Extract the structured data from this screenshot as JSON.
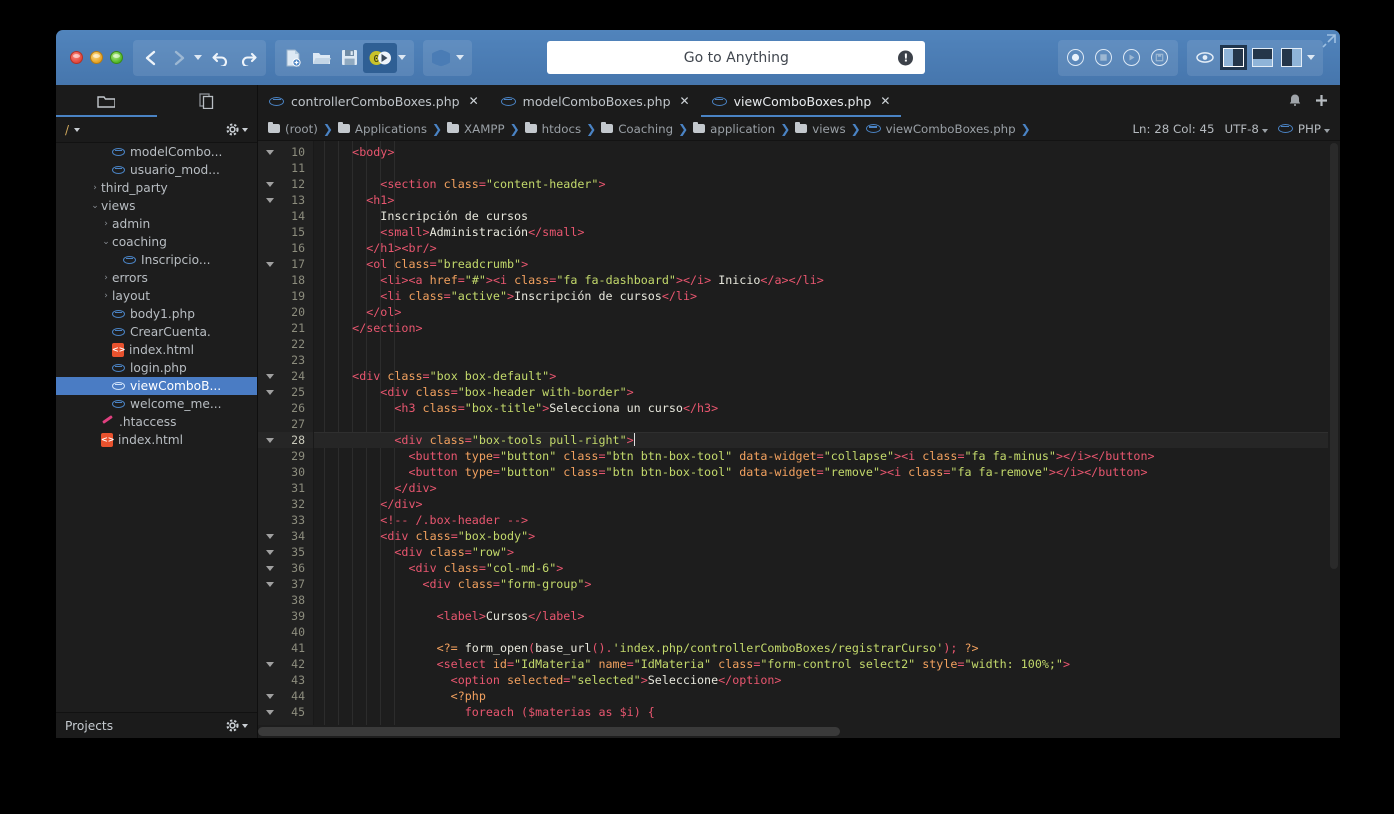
{
  "titlebar": {
    "traffic_lights": [
      "close",
      "minimize",
      "zoom"
    ],
    "nav": {
      "back": "back-icon",
      "forward": "forward-icon",
      "undo": "undo-icon",
      "redo": "redo-icon"
    },
    "file_tools": {
      "new": "new-file-icon",
      "open": "open-folder-icon",
      "save": "save-icon",
      "debug": "debug-icon",
      "preview": "globe-icon"
    },
    "search": {
      "placeholder": "Go to Anything",
      "value": "Go to Anything",
      "info_glyph": "!"
    },
    "run_tools": [
      "record-icon",
      "stop-icon",
      "play-icon",
      "save-macro-icon"
    ],
    "view_tools": [
      "eye-icon",
      "layout-left-icon",
      "layout-bottom-icon",
      "layout-right-icon"
    ],
    "expand": "expand-icon"
  },
  "side_tabs": [
    {
      "name": "places",
      "icon": "folder-icon",
      "active": true
    },
    {
      "name": "open-files",
      "icon": "files-icon",
      "active": false
    }
  ],
  "file_tabs": [
    {
      "label": "controllerComboBoxes.php",
      "icon": "php-icon",
      "active": false,
      "close": "✕"
    },
    {
      "label": "modelComboBoxes.php",
      "icon": "php-icon",
      "active": false,
      "close": "✕"
    },
    {
      "label": "viewComboBoxes.php",
      "icon": "php-icon",
      "active": true,
      "close": "✕"
    }
  ],
  "tabstrip_right": {
    "bell": "bell-icon",
    "plus": "plus-icon"
  },
  "sidebar": {
    "header": {
      "path": "/",
      "caret": "▾",
      "gear": "gear-icon"
    },
    "footer": {
      "label": "Projects",
      "gear": "gear-icon"
    },
    "tree": [
      {
        "label": "modelCombo...",
        "icon": "php-icon",
        "indent": 4,
        "twisty": "",
        "selected": false
      },
      {
        "label": "usuario_mod...",
        "icon": "php-icon",
        "indent": 4,
        "twisty": "",
        "selected": false
      },
      {
        "label": "third_party",
        "icon": "none",
        "indent": 3,
        "twisty": "›",
        "selected": false
      },
      {
        "label": "views",
        "icon": "none",
        "indent": 3,
        "twisty": "⌄",
        "selected": false
      },
      {
        "label": "admin",
        "icon": "none",
        "indent": 4,
        "twisty": "›",
        "selected": false
      },
      {
        "label": "coaching",
        "icon": "none",
        "indent": 4,
        "twisty": "⌄",
        "selected": false
      },
      {
        "label": "Inscripcio...",
        "icon": "php-icon",
        "indent": 5,
        "twisty": "",
        "selected": false
      },
      {
        "label": "errors",
        "icon": "none",
        "indent": 4,
        "twisty": "›",
        "selected": false
      },
      {
        "label": "layout",
        "icon": "none",
        "indent": 4,
        "twisty": "›",
        "selected": false
      },
      {
        "label": "body1.php",
        "icon": "php-icon",
        "indent": 4,
        "twisty": "",
        "selected": false
      },
      {
        "label": "CrearCuenta.",
        "icon": "php-icon",
        "indent": 4,
        "twisty": "",
        "selected": false
      },
      {
        "label": "index.html",
        "icon": "html-icon",
        "indent": 4,
        "twisty": "",
        "selected": false
      },
      {
        "label": "login.php",
        "icon": "php-icon",
        "indent": 4,
        "twisty": "",
        "selected": false
      },
      {
        "label": "viewComboB...",
        "icon": "php-icon",
        "indent": 4,
        "twisty": "",
        "selected": true
      },
      {
        "label": "welcome_me...",
        "icon": "php-icon",
        "indent": 4,
        "twisty": "",
        "selected": false
      },
      {
        "label": ".htaccess",
        "icon": "access-icon",
        "indent": 3,
        "twisty": "",
        "selected": false
      },
      {
        "label": "index.html",
        "icon": "html-icon",
        "indent": 3,
        "twisty": "",
        "selected": false
      }
    ]
  },
  "breadcrumb": {
    "items": [
      {
        "label": "(root)",
        "icon": "folder-icon"
      },
      {
        "label": "Applications",
        "icon": "folder-icon"
      },
      {
        "label": "XAMPP",
        "icon": "folder-icon"
      },
      {
        "label": "htdocs",
        "icon": "folder-icon"
      },
      {
        "label": "Coaching",
        "icon": "folder-icon"
      },
      {
        "label": "application",
        "icon": "folder-icon"
      },
      {
        "label": "views",
        "icon": "folder-icon"
      },
      {
        "label": "viewComboBoxes.php",
        "icon": "php-icon"
      }
    ],
    "separator": "❯",
    "status": {
      "position": "Ln: 28 Col: 45",
      "encoding": "UTF-8",
      "language": "PHP"
    }
  },
  "editor": {
    "first_line": 10,
    "current_line": 28,
    "lines": [
      {
        "n": 10,
        "fold": true,
        "text": "    <body>"
      },
      {
        "n": 11,
        "fold": false,
        "text": ""
      },
      {
        "n": 12,
        "fold": true,
        "text": "        <section class=\"content-header\">"
      },
      {
        "n": 13,
        "fold": true,
        "text": "      <h1>"
      },
      {
        "n": 14,
        "fold": false,
        "text": "        Inscripción de cursos"
      },
      {
        "n": 15,
        "fold": false,
        "text": "        <small>Administración</small>"
      },
      {
        "n": 16,
        "fold": false,
        "text": "      </h1><br/>"
      },
      {
        "n": 17,
        "fold": true,
        "text": "      <ol class=\"breadcrumb\">"
      },
      {
        "n": 18,
        "fold": false,
        "text": "        <li><a href=\"#\"><i class=\"fa fa-dashboard\"></i> Inicio</a></li>"
      },
      {
        "n": 19,
        "fold": false,
        "text": "        <li class=\"active\">Inscripción de cursos</li>"
      },
      {
        "n": 20,
        "fold": false,
        "text": "      </ol>"
      },
      {
        "n": 21,
        "fold": false,
        "text": "    </section>"
      },
      {
        "n": 22,
        "fold": false,
        "text": ""
      },
      {
        "n": 23,
        "fold": false,
        "text": ""
      },
      {
        "n": 24,
        "fold": true,
        "text": "    <div class=\"box box-default\">"
      },
      {
        "n": 25,
        "fold": true,
        "text": "        <div class=\"box-header with-border\">"
      },
      {
        "n": 26,
        "fold": false,
        "text": "          <h3 class=\"box-title\">Selecciona un curso</h3>"
      },
      {
        "n": 27,
        "fold": false,
        "text": ""
      },
      {
        "n": 28,
        "fold": true,
        "text": "          <div class=\"box-tools pull-right\">"
      },
      {
        "n": 29,
        "fold": false,
        "text": "            <button type=\"button\" class=\"btn btn-box-tool\" data-widget=\"collapse\"><i class=\"fa fa-minus\"></i></button>"
      },
      {
        "n": 30,
        "fold": false,
        "text": "            <button type=\"button\" class=\"btn btn-box-tool\" data-widget=\"remove\"><i class=\"fa fa-remove\"></i></button>"
      },
      {
        "n": 31,
        "fold": false,
        "text": "          </div>"
      },
      {
        "n": 32,
        "fold": false,
        "text": "        </div>"
      },
      {
        "n": 33,
        "fold": false,
        "text": "        <!-- /.box-header -->"
      },
      {
        "n": 34,
        "fold": true,
        "text": "        <div class=\"box-body\">"
      },
      {
        "n": 35,
        "fold": true,
        "text": "          <div class=\"row\">"
      },
      {
        "n": 36,
        "fold": true,
        "text": "            <div class=\"col-md-6\">"
      },
      {
        "n": 37,
        "fold": true,
        "text": "              <div class=\"form-group\">"
      },
      {
        "n": 38,
        "fold": false,
        "text": ""
      },
      {
        "n": 39,
        "fold": false,
        "text": "                <label>Cursos</label>"
      },
      {
        "n": 40,
        "fold": false,
        "text": ""
      },
      {
        "n": 41,
        "fold": false,
        "text": "                <?= form_open(base_url().'index.php/controllerComboBoxes/registrarCurso'); ?>"
      },
      {
        "n": 42,
        "fold": true,
        "text": "                <select id=\"IdMateria\" name=\"IdMateria\" class=\"form-control select2\" style=\"width: 100%;\">"
      },
      {
        "n": 43,
        "fold": false,
        "text": "                  <option selected=\"selected\">Seleccione</option>"
      },
      {
        "n": 44,
        "fold": true,
        "text": "                  <?php"
      },
      {
        "n": 45,
        "fold": true,
        "text": "                    foreach ($materias as $i) {"
      }
    ]
  },
  "colors": {
    "titlebar": "#4a7cb5",
    "accent": "#4a83c4",
    "editor_bg": "#1d1d1d",
    "gutter_bg": "#212121",
    "tag": "#e8566f",
    "attr": "#f2a15f",
    "string": "#c3d96b",
    "text": "#e8e8dd",
    "selection": "#4a7cc4"
  }
}
